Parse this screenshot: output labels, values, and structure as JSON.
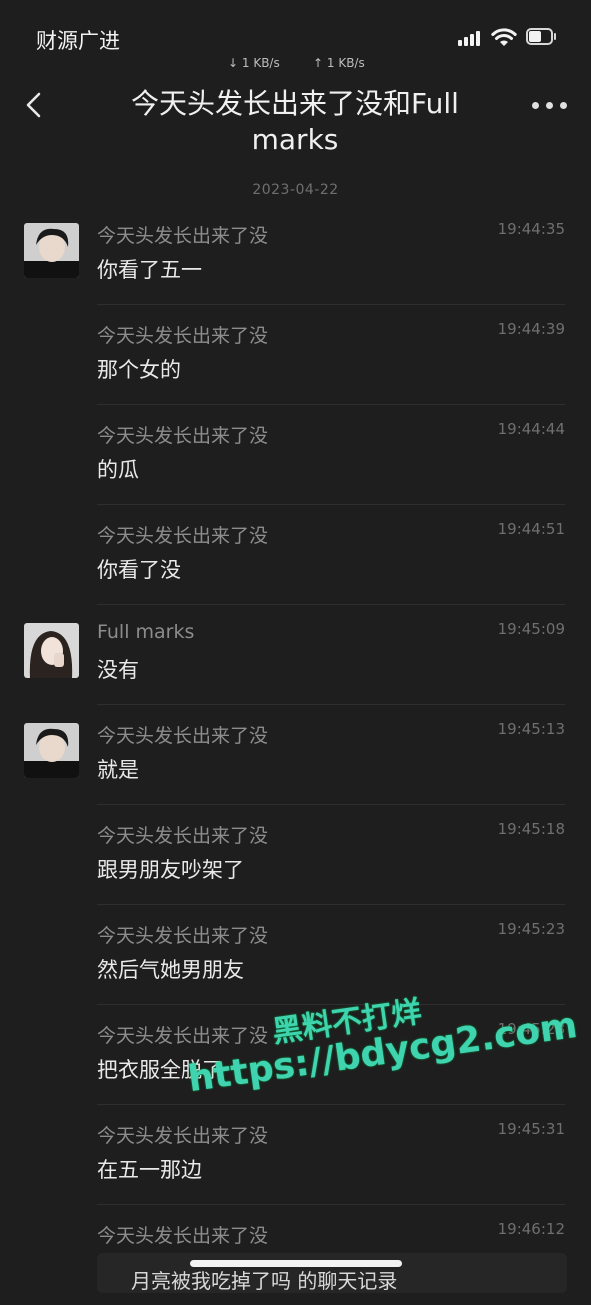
{
  "status_bar": {
    "carrier": "财源广进",
    "down_speed": "↓ 1 KB/s",
    "up_speed": "↑ 1 KB/s",
    "icons": [
      "signal-icon",
      "wifi-icon",
      "battery-icon"
    ]
  },
  "nav": {
    "back_icon": "chevron-left-icon",
    "title": "今天头发长出来了没和Full marks",
    "more_icon": "more-dots-icon"
  },
  "date_header": "2023-04-22",
  "messages": [
    {
      "sender": "今天头发长出来了没",
      "time": "19:44:35",
      "text": "你看了五一",
      "avatar": "boy"
    },
    {
      "sender": "今天头发长出来了没",
      "time": "19:44:39",
      "text": "那个女的",
      "avatar": ""
    },
    {
      "sender": "今天头发长出来了没",
      "time": "19:44:44",
      "text": "的瓜",
      "avatar": ""
    },
    {
      "sender": "今天头发长出来了没",
      "time": "19:44:51",
      "text": "你看了没",
      "avatar": ""
    },
    {
      "sender": "Full marks",
      "time": "19:45:09",
      "text": "没有",
      "avatar": "girl"
    },
    {
      "sender": "今天头发长出来了没",
      "time": "19:45:13",
      "text": "就是",
      "avatar": "boy"
    },
    {
      "sender": "今天头发长出来了没",
      "time": "19:45:18",
      "text": "跟男朋友吵架了",
      "avatar": ""
    },
    {
      "sender": "今天头发长出来了没",
      "time": "19:45:23",
      "text": "然后气她男朋友",
      "avatar": ""
    },
    {
      "sender": "今天头发长出来了没",
      "time": "19:45:28",
      "text": "把衣服全脱了",
      "avatar": ""
    },
    {
      "sender": "今天头发长出来了没",
      "time": "19:45:31",
      "text": "在五一那边",
      "avatar": ""
    },
    {
      "sender": "今天头发长出来了没",
      "time": "19:46:12",
      "text": "",
      "avatar": ""
    }
  ],
  "quote_card_text": "月亮被我吃掉了吗 的聊天记录",
  "watermark": {
    "line1": "黑料不打烊",
    "line2": "https://bdycg2.com"
  },
  "colors": {
    "background": "#1e1e1e",
    "watermark": "#3fd3b0"
  }
}
